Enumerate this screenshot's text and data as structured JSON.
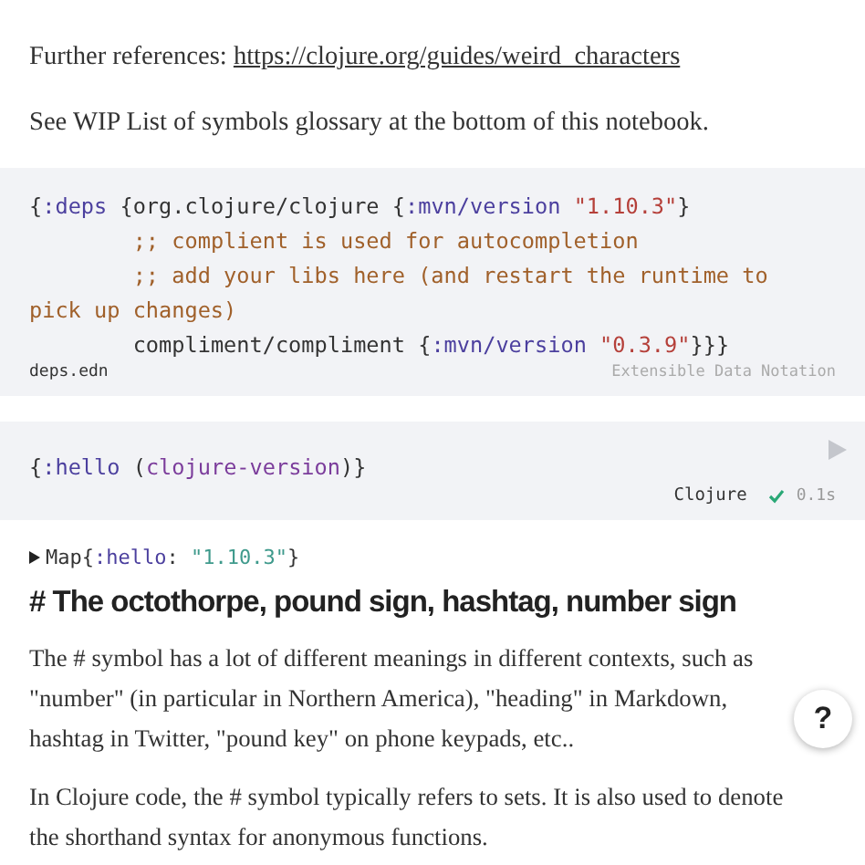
{
  "intro": [
    {
      "text": "Further references: ",
      "link": "https://clojure.org/guides/weird_characters"
    },
    {
      "text": "See WIP List of symbols glossary at the bottom of this notebook."
    }
  ],
  "cells": [
    {
      "kind": "static",
      "filename": "deps.edn",
      "language": "Extensible Data Notation",
      "lines": [
        [
          {
            "kind": "plain",
            "text": "{"
          },
          {
            "kind": "keyword",
            "text": ":deps"
          },
          {
            "kind": "plain",
            "text": " {org.clojure/clojure {"
          },
          {
            "kind": "keyword",
            "text": ":mvn/version"
          },
          {
            "kind": "string",
            "text": " \"1.10.3\""
          },
          {
            "kind": "plain",
            "text": "}"
          }
        ],
        [
          {
            "kind": "comment",
            "text": "        ;; complient is used for autocompletion"
          }
        ],
        [
          {
            "kind": "comment",
            "text": "        ;; add your libs here (and restart the runtime to pick up changes)"
          }
        ],
        [
          {
            "kind": "plain",
            "text": "        compliment/compliment {"
          },
          {
            "kind": "keyword",
            "text": ":mvn/version"
          },
          {
            "kind": "string",
            "text": " \"0.3.9\""
          },
          {
            "kind": "plain",
            "text": "}}}"
          }
        ]
      ]
    },
    {
      "kind": "runnable",
      "language": "Clojure",
      "success": true,
      "time": "0.1s",
      "lines": [
        [
          {
            "kind": "plain",
            "text": "{"
          },
          {
            "kind": "keyword",
            "text": ":hello"
          },
          {
            "kind": "plain",
            "text": " ("
          },
          {
            "kind": "call",
            "text": "clojure-version"
          },
          {
            "kind": "plain",
            "text": ")}"
          }
        ]
      ],
      "result": {
        "expanded": false,
        "tokens": [
          {
            "kind": "plain",
            "text": "Map{"
          },
          {
            "kind": "keyword",
            "text": ":hello"
          },
          {
            "kind": "plain",
            "text": ": "
          },
          {
            "kind": "result-string",
            "text": "\"1.10.3\""
          },
          {
            "kind": "plain",
            "text": "}"
          }
        ]
      }
    }
  ],
  "heading": "# The octothorpe, pound sign, hashtag, number sign",
  "paragraphs": [
    "The # symbol has a lot of different meanings in different contexts, such as \"number\" (in particular in Northern America), \"heading\" in Markdown, hashtag in Twitter, \"pound key\" on phone keypads, etc..",
    "In Clojure code, the # symbol typically refers to sets. It is also used to denote the shorthand syntax for anonymous functions."
  ],
  "help_button": "?"
}
